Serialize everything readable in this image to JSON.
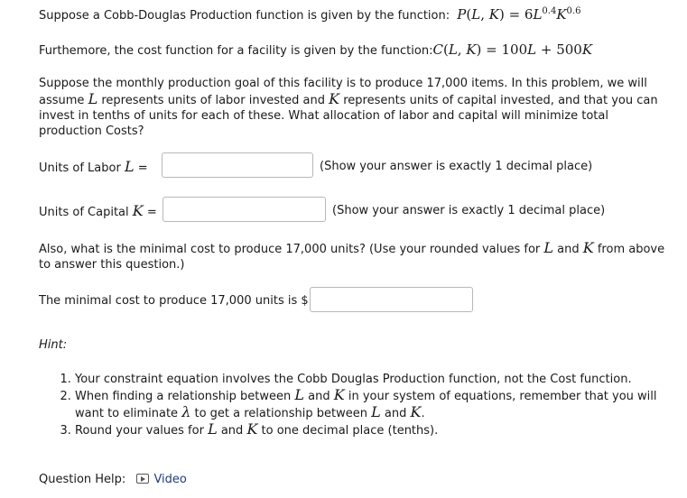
{
  "question": {
    "intro_prefix": "Suppose a Cobb-Douglas Production function is given by the function:",
    "production_fn": "P(L,K)=6L^0.4K^0.6",
    "cost_prefix": "Furthemore, the cost function for a facility is given by the function:",
    "cost_fn": "C(L,K)=100L+500K",
    "p3_a": "Suppose the monthly production goal of this facility is to produce 17,000 items. In this problem, we will assume",
    "p3_b": "represents units of labor invested and",
    "p3_c": "represents units of capital invested, and that you can invest in tenths of units for each of these. What allocation of labor and capital will minimize total production Costs?",
    "labor_label": "Units of Labor",
    "labor_eq": "=",
    "labor_note": "(Show your answer is exactly 1 decimal place)",
    "capital_label": "Units of Capital",
    "capital_eq": "=",
    "capital_note": "(Show your answer is exactly 1 decimal place)",
    "also_a": "Also, what is the minimal cost to produce 17,000 units? (Use your rounded values for",
    "also_and": "and",
    "also_b": "from above to answer this question.)",
    "mincost_label": "The minimal cost to produce 17,000 units is $",
    "labor_value": "",
    "capital_value": "",
    "mincost_value": ""
  },
  "hint": {
    "title": "Hint:",
    "h1": "Your constraint equation involves the Cobb Douglas Production function, not the Cost function.",
    "h2a": "When finding a relationship between",
    "h2b": "in your system of equations, remember that you will want to eliminate",
    "h2c": "to get a relationship between",
    "h3a": "Round your values for",
    "h3b": "to one decimal place (tenths).",
    "and": "and",
    "L": "L",
    "K": "K",
    "lambda": "λ"
  },
  "help": {
    "label": "Question Help:",
    "video": "Video",
    "video_icon": "video-icon"
  }
}
